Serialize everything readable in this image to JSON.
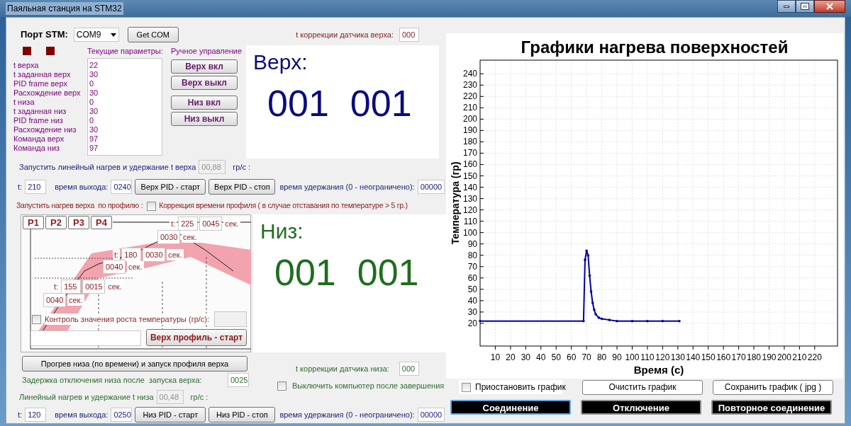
{
  "window": {
    "title": "Паяльная станция на STM32"
  },
  "port": {
    "label": "Порт STM:",
    "value": "COM9",
    "button": "Get COM"
  },
  "indicators": [
    {
      "color": "#800000"
    },
    {
      "color": "#800000"
    }
  ],
  "top_correction": {
    "label": "t коррекции датчика верха:",
    "value": "000"
  },
  "params": {
    "header": "Текущие параметры:",
    "rows": [
      {
        "label": "t верха",
        "value": "22"
      },
      {
        "label": "t заданная верх",
        "value": "30"
      },
      {
        "label": "PID frame верх",
        "value": "0"
      },
      {
        "label": "Расхождение верх",
        "value": "30"
      },
      {
        "label": "t низа",
        "value": "0"
      },
      {
        "label": "t заданная низ",
        "value": "30"
      },
      {
        "label": "PID frame низ",
        "value": "0"
      },
      {
        "label": "Расхождение низ",
        "value": "30"
      },
      {
        "label": "Команда верх",
        "value": "97"
      },
      {
        "label": "Команда низ",
        "value": "97"
      }
    ]
  },
  "manual": {
    "header": "Ручное управление",
    "buttons": [
      "Верх вкл",
      "Верх выкл",
      "Низ вкл",
      "Низ выкл"
    ]
  },
  "top_display": {
    "title": "Верх:",
    "value_1": "001",
    "value_2": "001"
  },
  "top_linear": {
    "label": "Запустить линейный нагрев и удержание t верха",
    "rate": "00,88",
    "rate_disabled": true,
    "unit": "гр/с :",
    "t_label": "t:",
    "t_value": "210",
    "exit_label": "время выхода:",
    "exit_value": "0240",
    "start": "Верх PID - старт",
    "stop": "Верх PID - стоп",
    "hold_label": "время удержания (0 - неограничено):",
    "hold_value": "00000"
  },
  "profile": {
    "label": "Запустить нагрев верха  по профилю :",
    "correction": {
      "label": "Коррекция времени профиля ( в случае отставания по температуре > 5 гр.)",
      "checked": false
    },
    "presets": [
      "P1",
      "P2",
      "P3",
      "P4"
    ],
    "steps": [
      {
        "t_label": "t:",
        "t": "225",
        "time": "0045",
        "unit": "сек."
      },
      {
        "time": "0030",
        "unit": "сек."
      },
      {
        "t_label": "t:",
        "t": "180",
        "time": "0030",
        "unit": "сек."
      },
      {
        "time": "0040",
        "unit": "сек."
      },
      {
        "t_label": "t:",
        "t": "155",
        "time": "0015",
        "unit": "сек."
      },
      {
        "time": "0040",
        "unit": "сек."
      }
    ],
    "rate_control": {
      "label": "Контроль значения роста температуры (гр/с):",
      "checked": false
    },
    "start": "Верх профиль - старт"
  },
  "bottom_display": {
    "title": "Низ:",
    "value_1": "001",
    "value_2": "001"
  },
  "preheat_button": "Прогрев низа (по времени) и запуск профиля верха",
  "bottom_correction": {
    "label": "t коррекции датчика низа:",
    "value": "000"
  },
  "delay": {
    "label": "Задержка отключения низа после  запуска верха:",
    "value": "0025"
  },
  "shutdown": {
    "label": "Выключить компьютер после завершения",
    "checked": false
  },
  "bottom_linear": {
    "label": "Линейный нагрев и удержание t низа",
    "rate": "00,48",
    "rate_disabled": true,
    "unit": "гр/с :",
    "t_label": "t:",
    "t_value": "120",
    "exit_label": "время выхода:",
    "exit_value": "0250",
    "start": "Низ PID - старт",
    "stop": "Низ PID - стоп",
    "hold_label": "время удержания (0 - неограничено):",
    "hold_value": "00000"
  },
  "chart": {
    "chart_data": {
      "type": "line",
      "title": "Графики нагрева поверхностей",
      "xlabel": "Время (с)",
      "ylabel": "Температура (гр)",
      "x": [
        0,
        68,
        69,
        70,
        71,
        72,
        73,
        74,
        75,
        76,
        78,
        80,
        85,
        90,
        100,
        110,
        120,
        131
      ],
      "grid": true,
      "series": [
        {
          "color": "#0000a0",
          "values": [
            22,
            22,
            76,
            84,
            80,
            62,
            48,
            38,
            32,
            28,
            25,
            24,
            23,
            22,
            22,
            22,
            22,
            22
          ]
        }
      ],
      "xlim": [
        0,
        235
      ],
      "ylim": [
        0,
        252
      ],
      "xticks": [
        10,
        20,
        30,
        40,
        50,
        60,
        70,
        80,
        90,
        100,
        110,
        120,
        130,
        140,
        150,
        160,
        170,
        180,
        190,
        200,
        210,
        220
      ],
      "yticks": [
        20,
        30,
        40,
        50,
        60,
        70,
        80,
        90,
        100,
        110,
        120,
        130,
        140,
        150,
        160,
        170,
        180,
        190,
        200,
        210,
        220,
        230,
        240
      ]
    }
  },
  "pause": {
    "label": "Приостановить график",
    "checked": false
  },
  "chart_buttons": [
    "Очистить график",
    "Сохранить график ( jpg )"
  ],
  "connection_buttons": [
    {
      "label": "Соединение",
      "focused": true
    },
    {
      "label": "Отключение",
      "focused": false
    },
    {
      "label": "Повторное соединение",
      "focused": false
    }
  ]
}
